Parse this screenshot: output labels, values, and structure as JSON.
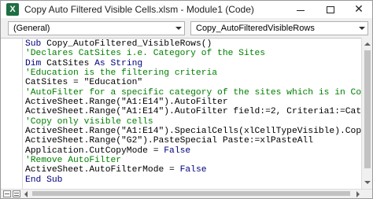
{
  "window": {
    "title": "Copy Auto Filtered Visible Cells.xlsm - Module1 (Code)",
    "app_icon_glyph": "X",
    "icons": {
      "app": "excel-icon",
      "minimize": "minimize-icon",
      "maximize": "maximize-icon",
      "close": "close-icon"
    },
    "close_glyph": "✕"
  },
  "dropdowns": {
    "object": {
      "value": "(General)"
    },
    "procedure": {
      "value": "Copy_AutoFilteredVisibleRows"
    }
  },
  "colors": {
    "keyword": "#00007f",
    "comment": "#007f00",
    "text": "#000000",
    "excel_green": "#1d6f42"
  },
  "code": {
    "lines": [
      [
        {
          "t": "kw",
          "s": "Sub "
        },
        {
          "t": "tx",
          "s": "Copy_AutoFiltered_VisibleRows()"
        }
      ],
      [
        {
          "t": "cm",
          "s": "'Declares CatSites i.e. Category of the Sites"
        }
      ],
      [
        {
          "t": "kw",
          "s": "Dim "
        },
        {
          "t": "tx",
          "s": "CatSites "
        },
        {
          "t": "kw",
          "s": "As String"
        }
      ],
      [
        {
          "t": "cm",
          "s": "'Education is the filtering criteria"
        }
      ],
      [
        {
          "t": "tx",
          "s": "CatSites = \"Education\""
        }
      ],
      [
        {
          "t": "cm",
          "s": "'AutoFilter for a specific category of the sites which is in Column B"
        }
      ],
      [
        {
          "t": "tx",
          "s": "ActiveSheet.Range(\"A1:E14\").AutoFilter"
        }
      ],
      [
        {
          "t": "tx",
          "s": "ActiveSheet.Range(\"A1:E14\").AutoFilter field:=2, Criteria1:=CatSites"
        }
      ],
      [
        {
          "t": "cm",
          "s": "'Copy only visible cells"
        }
      ],
      [
        {
          "t": "tx",
          "s": "ActiveSheet.Range(\"A1:E14\").SpecialCells(xlCellTypeVisible).Copy"
        }
      ],
      [
        {
          "t": "tx",
          "s": "ActiveSheet.Range(\"G2\").PasteSpecial Paste:=xlPasteAll"
        }
      ],
      [
        {
          "t": "tx",
          "s": "Application.CutCopyMode = "
        },
        {
          "t": "kw",
          "s": "False"
        }
      ],
      [
        {
          "t": "cm",
          "s": "'Remove AutoFilter"
        }
      ],
      [
        {
          "t": "tx",
          "s": "ActiveSheet.AutoFilterMode = "
        },
        {
          "t": "kw",
          "s": "False"
        }
      ],
      [
        {
          "t": "kw",
          "s": "End Sub"
        }
      ]
    ]
  },
  "scroll": {
    "vertical_position": 0.0,
    "horizontal_position": 0.0
  },
  "view_buttons": [
    "procedure-view",
    "full-module-view"
  ]
}
